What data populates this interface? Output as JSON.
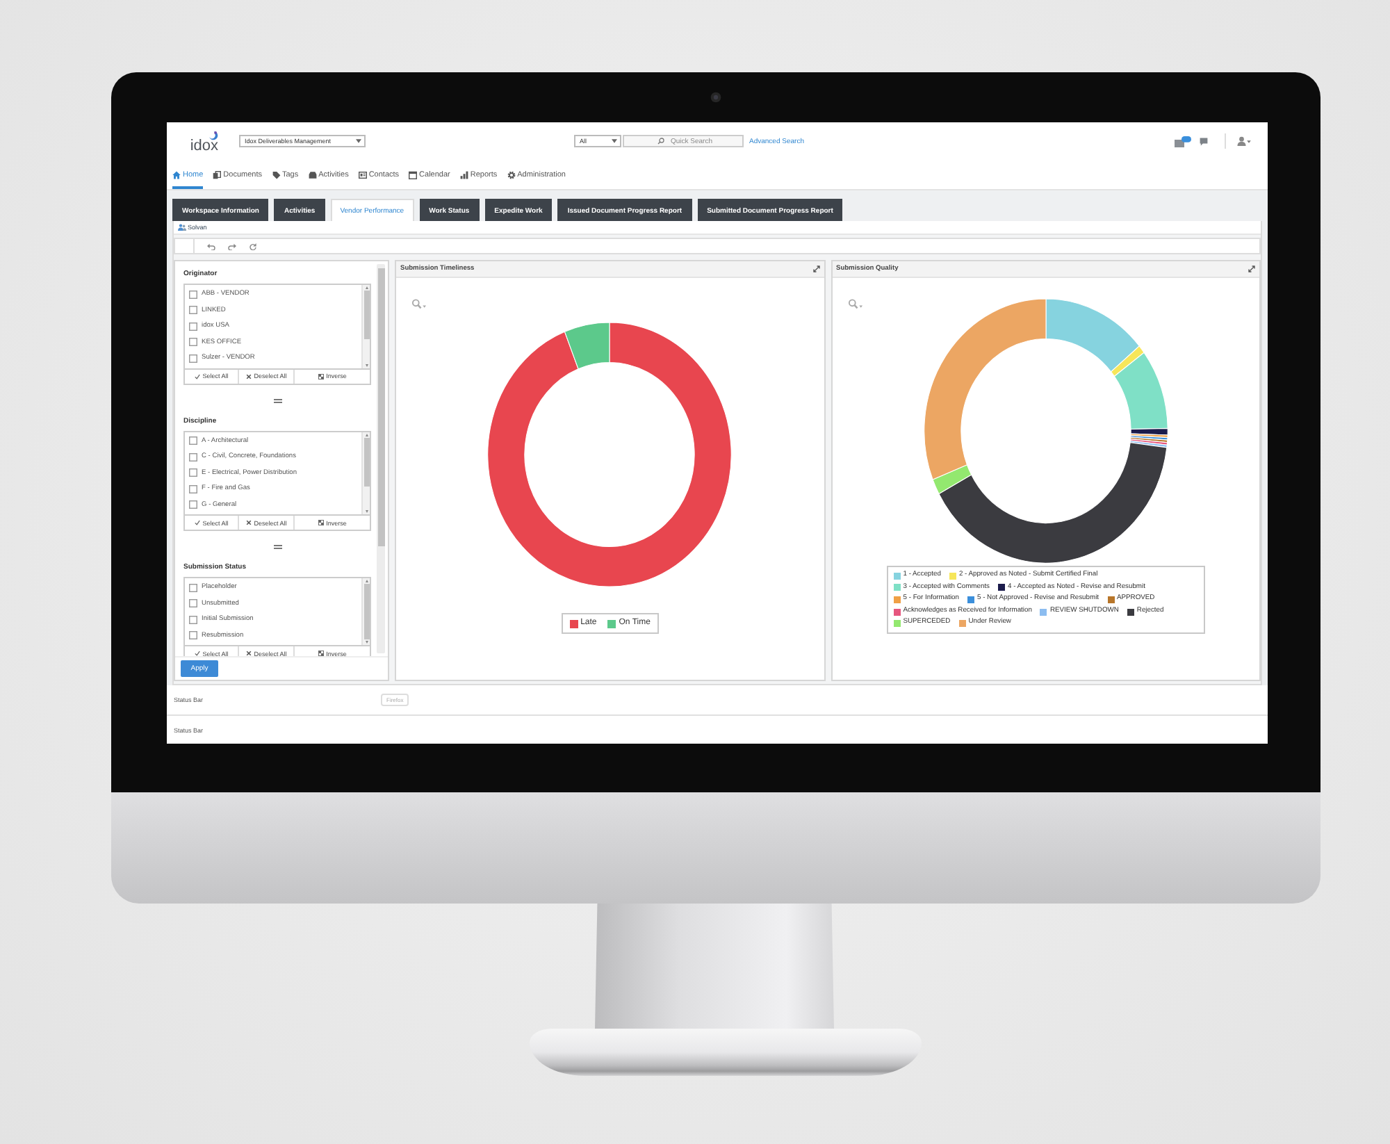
{
  "header": {
    "logo": "idox",
    "workspace_select": "Idox Deliverables Management",
    "scope_select": "All",
    "search": {
      "placeholder": "Quick Search"
    },
    "advanced_search_link": "Advanced Search"
  },
  "nav": [
    {
      "label": "Home",
      "selected": true
    },
    {
      "label": "Documents",
      "selected": false
    },
    {
      "label": "Tags",
      "selected": false
    },
    {
      "label": "Activities",
      "selected": false
    },
    {
      "label": "Contacts",
      "selected": false
    },
    {
      "label": "Calendar",
      "selected": false
    },
    {
      "label": "Reports",
      "selected": false
    },
    {
      "label": "Administration",
      "selected": false
    }
  ],
  "tabs": [
    {
      "label": "Workspace Information",
      "selected": false
    },
    {
      "label": "Activities",
      "selected": false
    },
    {
      "label": "Vendor Performance",
      "selected": true
    },
    {
      "label": "Work Status",
      "selected": false
    },
    {
      "label": "Expedite Work",
      "selected": false
    },
    {
      "label": "Issued Document Progress Report",
      "selected": false
    },
    {
      "label": "Submitted Document Progress Report",
      "selected": false
    }
  ],
  "toolbar": {
    "label": "Solvan"
  },
  "filters": [
    {
      "title": "Originator",
      "options": [
        {
          "label": "ABB - VENDOR",
          "checked": false
        },
        {
          "label": "LINKED",
          "checked": false
        },
        {
          "label": "idox USA",
          "checked": false
        },
        {
          "label": "KES OFFICE",
          "checked": false
        },
        {
          "label": "Sulzer - VENDOR",
          "checked": false
        }
      ],
      "buttons": [
        "Select All",
        "Deselect All",
        "Inverse"
      ]
    },
    {
      "title": "Discipline",
      "options": [
        {
          "label": "A - Architectural",
          "checked": false
        },
        {
          "label": "C - Civil, Concrete, Foundations",
          "checked": false
        },
        {
          "label": "E - Electrical, Power Distribution",
          "checked": false
        },
        {
          "label": "F - Fire and Gas",
          "checked": false
        },
        {
          "label": "G - General",
          "checked": false
        }
      ],
      "buttons": [
        "Select All",
        "Deselect All",
        "Inverse"
      ]
    },
    {
      "title": "Submission Status",
      "options": [
        {
          "label": "Placeholder",
          "checked": false
        },
        {
          "label": "Unsubmitted",
          "checked": false
        },
        {
          "label": "Initial Submission",
          "checked": false
        },
        {
          "label": "Resubmission",
          "checked": false
        }
      ],
      "buttons": [
        "Select All",
        "Deselect All",
        "Inverse"
      ]
    }
  ],
  "apply_button": "Apply",
  "charts": [
    {
      "title": "Submission Timeliness",
      "legend": [
        {
          "label": "Late",
          "color": "#e8464f"
        },
        {
          "label": "On Time",
          "color": "#5cc98b"
        }
      ]
    },
    {
      "title": "Submission Quality",
      "legend": [
        {
          "label": "1 - Accepted",
          "color": "#86d3df"
        },
        {
          "label": "2 - Approved as Noted - Submit Certified Final",
          "color": "#f6e65a"
        },
        {
          "label": "3 - Accepted with Comments",
          "color": "#7fe0c6"
        },
        {
          "label": "4 - Accepted as Noted - Revise and Resubmit",
          "color": "#1c1c4c"
        },
        {
          "label": "5 - For Information",
          "color": "#f0a046"
        },
        {
          "label": "5 - Not Approved - Revise and Resubmit",
          "color": "#3b8fdb"
        },
        {
          "label": "APPROVED",
          "color": "#b8762a"
        },
        {
          "label": "Acknowledges as Received for Information",
          "color": "#e6567e"
        },
        {
          "label": "REVIEW SHUTDOWN",
          "color": "#8cbdf0"
        },
        {
          "label": "Rejected",
          "color": "#3b3b40"
        },
        {
          "label": "SUPERCEDED",
          "color": "#93e86f"
        },
        {
          "label": "Under Review",
          "color": "#eca663"
        }
      ]
    }
  ],
  "status_bars": [
    {
      "label": "Status Bar",
      "button": "Firefox"
    },
    {
      "label": "Status Bar"
    }
  ]
}
